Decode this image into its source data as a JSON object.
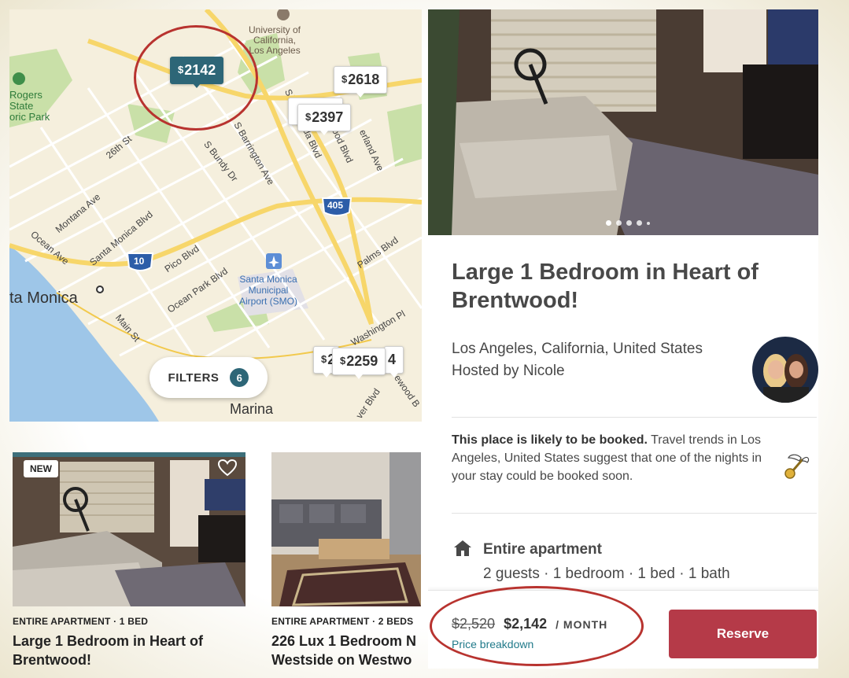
{
  "map": {
    "labels": {
      "university": "University of\nCalifornia,\nLos Angeles",
      "park": "Rogers\nState\noric Park",
      "sixth": "26th St",
      "montana": "Montana Ave",
      "ocean": "Ocean Ave",
      "smb": "Santa Monica Blvd",
      "pico": "Pico Blvd",
      "oceanpark": "Ocean Park Blvd",
      "main": "Main St",
      "santamonica": "ta Monica",
      "airport": "Santa Monica\nMunicipal\nAirport (SMO)",
      "bundy": "S Bundy Dr",
      "barrington": "S Barrington Ave",
      "sepulveda": "S Sepulveda Blvd",
      "sawtelle": "ood Blvd",
      "federal": "erland Ave",
      "palms": "Palms Blvd",
      "washington": "Washington Pl",
      "marina": "Marina",
      "lincoln": "ver Blvd",
      "ewood": "ewood B",
      "i405": "405",
      "i10": "10"
    },
    "pins": {
      "p1": "2142",
      "p2": "2618",
      "p3": "2397",
      "p4": "2259",
      "p5": "2",
      "p6": "4",
      "currency": "$"
    },
    "filters": {
      "label": "FILTERS",
      "count": "6"
    }
  },
  "cards": [
    {
      "badge": "NEW",
      "meta": "ENTIRE APARTMENT · 1 BED",
      "title": "Large 1 Bedroom in Heart of Brentwood!"
    },
    {
      "meta": "ENTIRE APARTMENT · 2 BEDS",
      "title": "226 Lux 1  Bedroom N Westside on Westwo"
    }
  ],
  "listing": {
    "title": "Large 1 Bedroom in Heart of Brentwood!",
    "location": "Los Angeles, California, United States",
    "host": "Hosted by Nicole",
    "likely_bold": "This place is likely to be booked.",
    "likely_text": " Travel trends in Los Angeles, United States suggest that one of the nights in your stay could be booked soon.",
    "type": "Entire apartment",
    "details": "2 guests · 1 bedroom · 1 bed · 1 bath",
    "photo_count": 5,
    "active_photo": 0
  },
  "booking": {
    "old_price": "$2,520",
    "price": "$2,142",
    "per": "/ MONTH",
    "breakdown": "Price breakdown",
    "reserve": "Reserve"
  },
  "colors": {
    "accent": "#2d6677",
    "reserve": "#b53a48",
    "link": "#217a8a",
    "annotation": "#b8332f"
  }
}
